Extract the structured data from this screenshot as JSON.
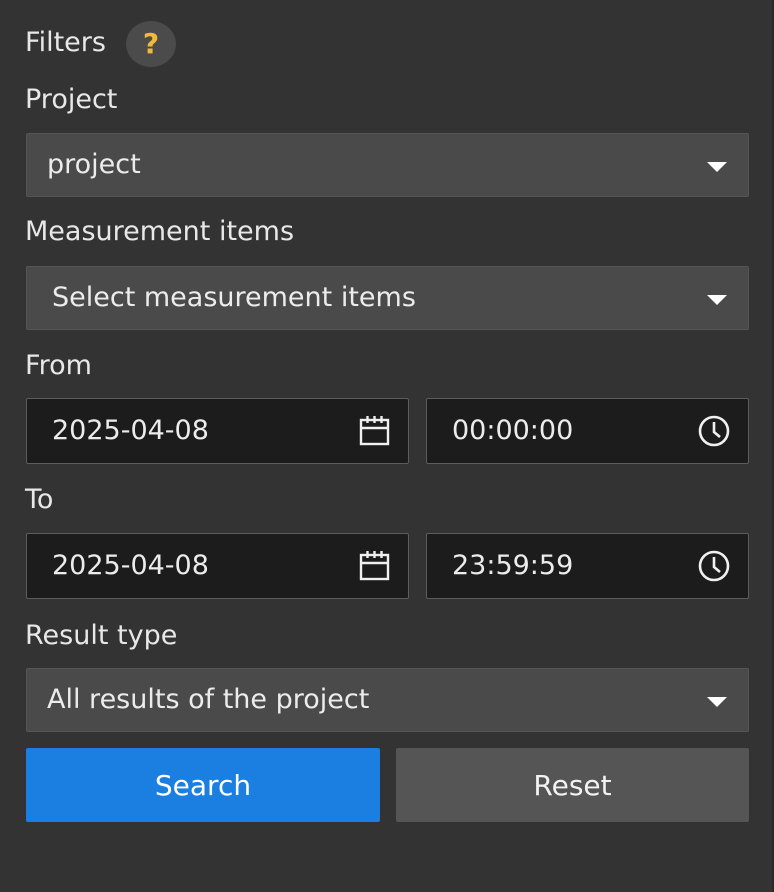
{
  "filters": {
    "title": "Filters",
    "help_label": "?",
    "project": {
      "label": "Project",
      "value": "project"
    },
    "measurement_items": {
      "label": "Measurement items",
      "placeholder": "Select measurement items"
    },
    "from": {
      "label": "From",
      "date": "2025-04-08",
      "time": "00:00:00"
    },
    "to": {
      "label": "To",
      "date": "2025-04-08",
      "time": "23:59:59"
    },
    "result_type": {
      "label": "Result type",
      "value": "All results of the project"
    },
    "search_label": "Search",
    "reset_label": "Reset"
  },
  "colors": {
    "panel_bg": "#333333",
    "input_bg": "#1c1c1c",
    "select_bg": "#4a4a4a",
    "accent": "#1a7fe0",
    "help_icon": "#f0b93a",
    "secondary_button": "#555555"
  },
  "icons": {
    "help": "question-mark-icon",
    "dropdown": "caret-down-icon",
    "date": "calendar-icon",
    "time": "clock-icon"
  }
}
